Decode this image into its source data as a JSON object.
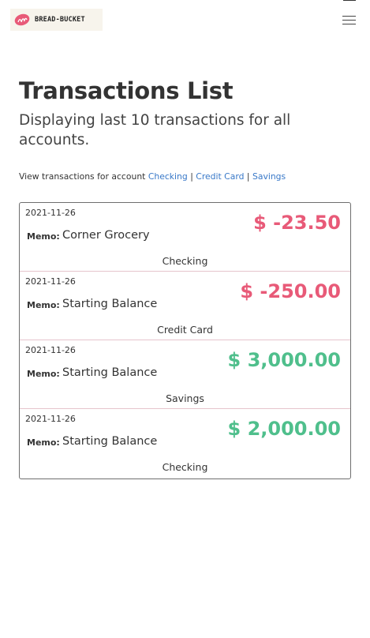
{
  "brand": {
    "name": "BREAD-BUCKET",
    "accent": "#e85a78"
  },
  "nav": {
    "menu_icon": "hamburger-menu-icon"
  },
  "page": {
    "title": "Transactions List",
    "subtitle": "Displaying last 10 transactions for all accounts."
  },
  "filter": {
    "prefix": "View transactions for account",
    "accounts": [
      "Checking",
      "Credit Card",
      "Savings"
    ],
    "separator": "|"
  },
  "memo_label": "Memo:",
  "transactions": [
    {
      "date": "2021-11-26",
      "memo": "Corner Grocery",
      "amount": "$ -23.50",
      "account": "Checking",
      "sign": "negative"
    },
    {
      "date": "2021-11-26",
      "memo": "Starting Balance",
      "amount": "$ -250.00",
      "account": "Credit Card",
      "sign": "negative"
    },
    {
      "date": "2021-11-26",
      "memo": "Starting Balance",
      "amount": "$ 3,000.00",
      "account": "Savings",
      "sign": "positive"
    },
    {
      "date": "2021-11-26",
      "memo": "Starting Balance",
      "amount": "$ 2,000.00",
      "account": "Checking",
      "sign": "positive"
    }
  ],
  "colors": {
    "negative": "#e85a78",
    "positive": "#4fbf8c",
    "link": "#3878c8"
  }
}
